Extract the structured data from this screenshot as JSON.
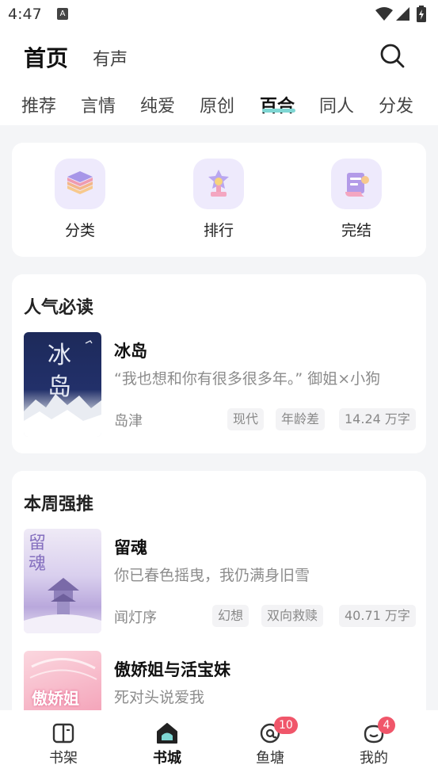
{
  "status_bar": {
    "time": "4:47"
  },
  "header": {
    "title": "首页",
    "subtitle": "有声"
  },
  "category_tabs": [
    {
      "label": "推荐"
    },
    {
      "label": "言情"
    },
    {
      "label": "纯爱"
    },
    {
      "label": "原创"
    },
    {
      "label": "百合",
      "active": true
    },
    {
      "label": "同人"
    },
    {
      "label": "分发"
    }
  ],
  "quick_links": [
    {
      "label": "分类",
      "icon": "layers-icon"
    },
    {
      "label": "排行",
      "icon": "trophy-star-icon"
    },
    {
      "label": "完结",
      "icon": "scroll-icon"
    }
  ],
  "popular": {
    "title": "人气必读",
    "books": [
      {
        "title": "冰岛",
        "cover_text": "冰 岛",
        "desc": "“我也想和你有很多很多年。” 御姐×小狗",
        "author": "岛津",
        "tags": [
          "现代",
          "年龄差",
          "14.24 万字"
        ]
      }
    ]
  },
  "weekly": {
    "title": "本周强推",
    "books": [
      {
        "title": "留魂",
        "cover_text": "留魂",
        "desc": "你已春色摇曳，我仍满身旧雪",
        "author": "闻灯序",
        "tags": [
          "幻想",
          "双向救赎",
          "40.71 万字"
        ]
      },
      {
        "title": "傲娇姐与活宝妹",
        "cover_text": "傲娇姐",
        "desc": "死对头说爱我",
        "author": "",
        "tags": []
      }
    ]
  },
  "bottom_nav": [
    {
      "label": "书架",
      "icon": "book-icon"
    },
    {
      "label": "书城",
      "icon": "home-icon",
      "active": true
    },
    {
      "label": "鱼塘",
      "icon": "at-icon",
      "badge": "10"
    },
    {
      "label": "我的",
      "icon": "profile-icon",
      "badge": "4"
    }
  ],
  "colors": {
    "accent": "#7fd6d3",
    "badge": "#f0566a",
    "icon_bg": "#eeeafc"
  }
}
